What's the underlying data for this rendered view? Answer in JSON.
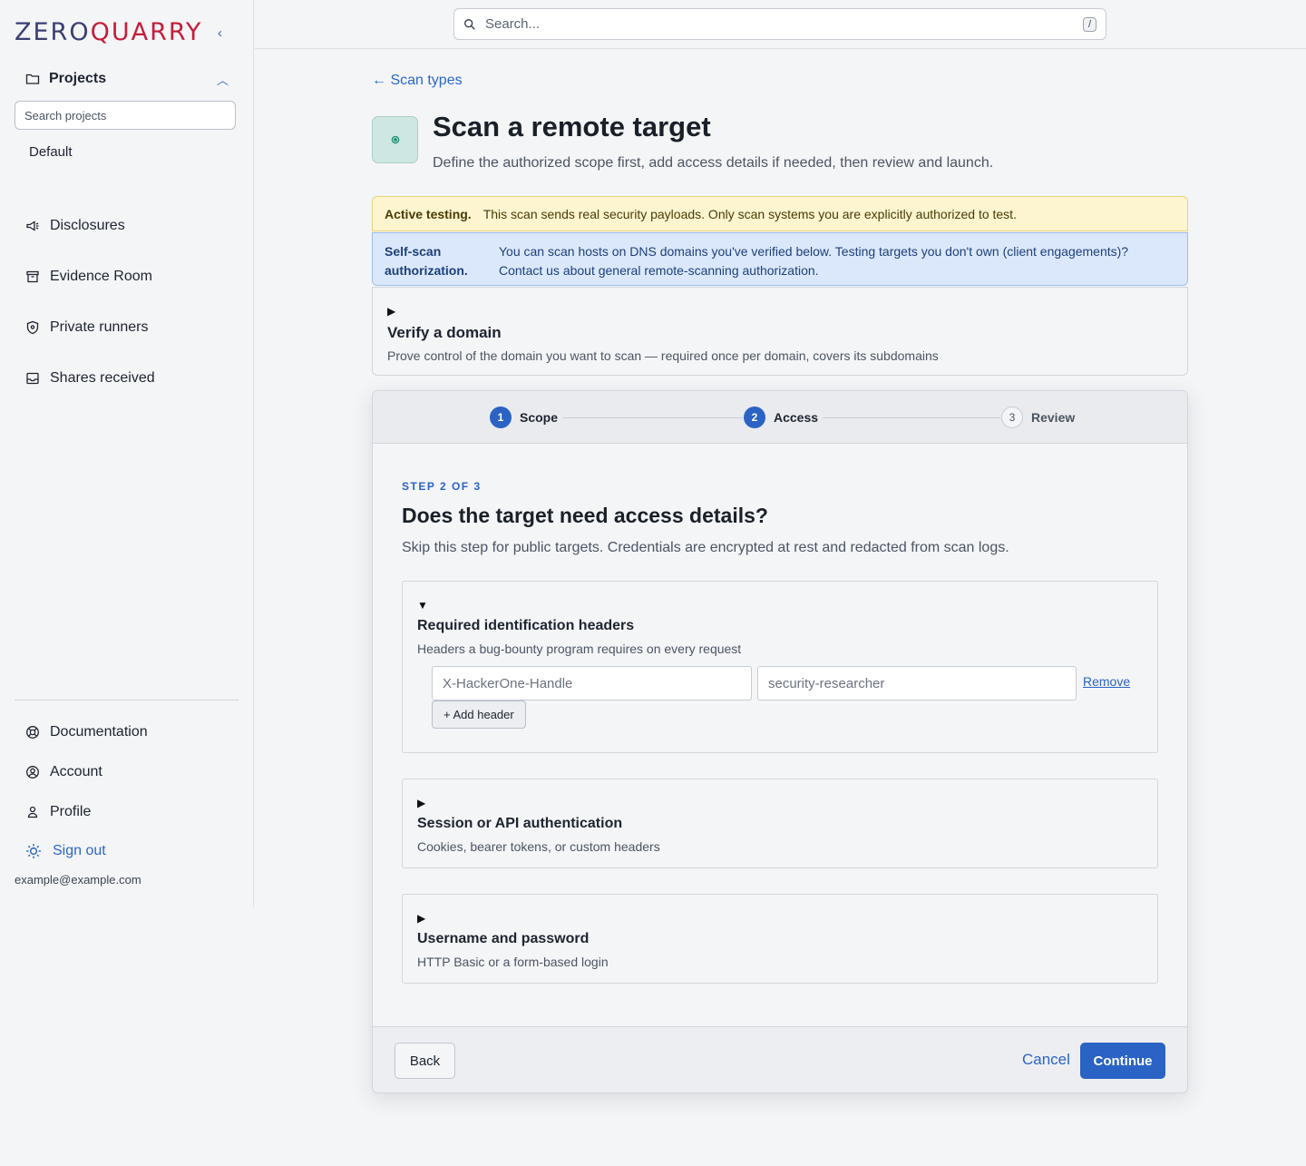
{
  "brand": {
    "left": "ZERO",
    "right": "QUARRY"
  },
  "sidebar": {
    "projects_label": "Projects",
    "search_placeholder": "Search projects",
    "default_project": "Default",
    "nav": [
      {
        "label": "Disclosures",
        "icon": "megaphone-icon"
      },
      {
        "label": "Evidence Room",
        "icon": "archive-icon"
      },
      {
        "label": "Private runners",
        "icon": "shield-icon"
      },
      {
        "label": "Shares received",
        "icon": "inbox-icon"
      }
    ],
    "footer_nav": [
      {
        "label": "Documentation",
        "icon": "lifebuoy-icon"
      },
      {
        "label": "Account",
        "icon": "user-circle-icon"
      },
      {
        "label": "Profile",
        "icon": "user-icon"
      },
      {
        "label": "Sign out",
        "icon": "sun-icon"
      }
    ],
    "email": "example@example.com"
  },
  "topbar": {
    "search_placeholder": "Search...",
    "shortcut": "/"
  },
  "main": {
    "back_label": "← Scan types",
    "title": "Scan a remote target",
    "subtitle": "Define the authorized scope first, add access details if needed, then review and launch.",
    "warning": {
      "label": "Active testing.",
      "text": "This scan sends real security payloads. Only scan systems you are explicitly authorized to test."
    },
    "info": {
      "label": "Self-scan authorization.",
      "text": "You can scan hosts on DNS domains you've verified below. Testing targets you don't own (client engagements)? Contact us about general remote-scanning authorization."
    },
    "verify": {
      "title": "Verify a domain",
      "desc": "Prove control of the domain you want to scan — required once per domain, covers its subdomains"
    }
  },
  "wizard": {
    "steps": [
      {
        "num": "1",
        "label": "Scope"
      },
      {
        "num": "2",
        "label": "Access"
      },
      {
        "num": "3",
        "label": "Review"
      }
    ],
    "kicker": "STEP 2 OF 3",
    "title": "Does the target need access details?",
    "desc": "Skip this step for public targets. Credentials are encrypted at rest and redacted from scan logs.",
    "sections": {
      "headers": {
        "title": "Required identification headers",
        "desc": "Headers a bug-bounty program requires on every request",
        "name_placeholder": "X-HackerOne-Handle",
        "value_placeholder": "security-researcher",
        "remove_label": "Remove",
        "add_label": "+ Add header"
      },
      "session": {
        "title": "Session or API authentication",
        "desc": "Cookies, bearer tokens, or custom headers"
      },
      "basic": {
        "title": "Username and password",
        "desc": "HTTP Basic or a form-based login"
      }
    },
    "footer": {
      "back": "Back",
      "cancel": "Cancel",
      "continue": "Continue"
    }
  },
  "colors": {
    "accent": "#2b63c4",
    "brand_dark": "#3a3f73",
    "brand_red": "#c41e3a",
    "warn_bg": "#fdf5cf",
    "info_bg": "#dbe8fb"
  }
}
